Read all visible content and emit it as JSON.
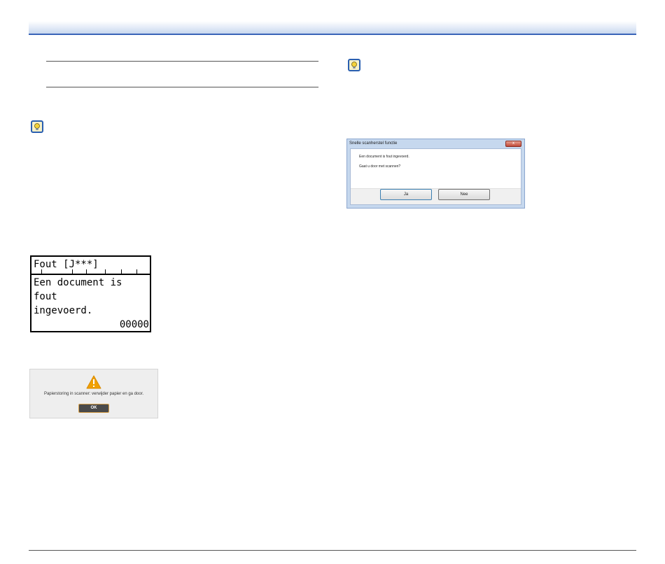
{
  "lcd": {
    "header": "Fout [J***]",
    "message_line1": "Een document is fout",
    "message_line2": "ingevoerd.",
    "counter": "00000"
  },
  "warning_dialog": {
    "icon": "warning-triangle-icon",
    "message": "Papierstoring in scanner: verwijder papier en ga door.",
    "ok_label": "OK"
  },
  "recovery_dialog": {
    "title": "Snelle scanherstel functie",
    "close_glyph": "x",
    "line1": "Een document is fout ingevoerd.",
    "line2": "Gaat u door met scannen?",
    "yes_label": "Ja",
    "no_label": "Nee"
  },
  "icons": {
    "tip": "lightbulb-tip-icon"
  },
  "colors": {
    "header_rule": "#3a64b8",
    "warning_accent": "#f0a000",
    "ok_border": "#d7a04a"
  }
}
